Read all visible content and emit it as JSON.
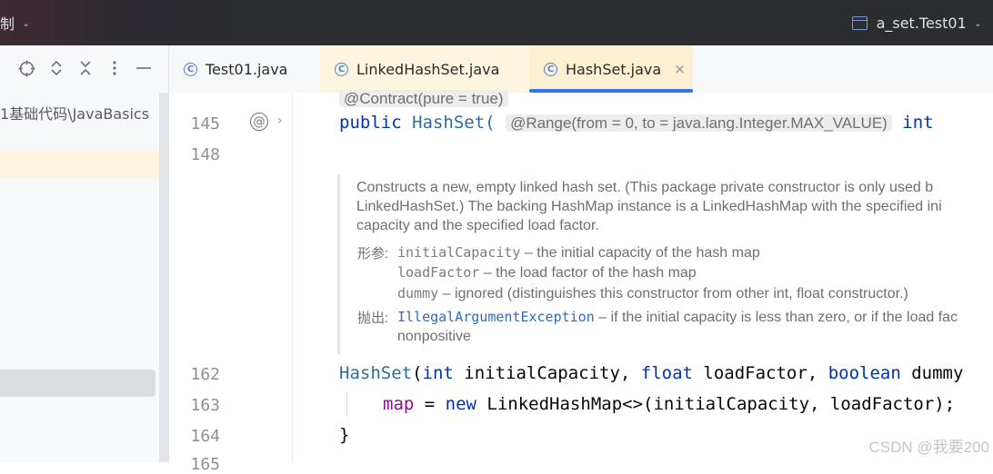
{
  "titlebar": {
    "left_text": "制",
    "run_config": "a_set.Test01"
  },
  "left_panel": {
    "path_text": "1基础代码\\JavaBasics"
  },
  "tabs": [
    {
      "label": "Test01.java",
      "active": false
    },
    {
      "label": "LinkedHashSet.java",
      "active": false
    },
    {
      "label": "HashSet.java",
      "active": true,
      "close": "×"
    }
  ],
  "editor": {
    "contract_hint": "@Contract(pure = true)",
    "lines": [
      {
        "number": "145"
      },
      {
        "number": "148"
      },
      {
        "number": "162"
      },
      {
        "number": "163"
      },
      {
        "number": "164"
      },
      {
        "number": "165"
      }
    ],
    "line145": {
      "kw_public": "public",
      "name": "HashSet(",
      "range_hint": "@Range(from = 0, to = java.lang.Integer.MAX_VALUE)",
      "kw_int": "int"
    },
    "line162": {
      "name": "HashSet",
      "p1": "(",
      "kw_int": "int",
      "t1": " initialCapacity, ",
      "kw_float": "float",
      "t2": " loadFactor, ",
      "kw_boolean": "boolean",
      "t3": " dummy"
    },
    "line163": {
      "field": "map",
      "t1": " = ",
      "kw_new": "new",
      "t2": " LinkedHashMap<>(initialCapacity, loadFactor);"
    },
    "line164": {
      "brace": "}"
    }
  },
  "javadoc": {
    "desc_line1": "Constructs a new, empty linked hash set. (This package private constructor is only used b",
    "desc_line2": "LinkedHashSet.) The backing HashMap instance is a LinkedHashMap with the specified ini",
    "desc_line3": "capacity and the specified load factor.",
    "params_label": "形参:",
    "params": [
      {
        "name": "initialCapacity",
        "desc": " – the initial capacity of the hash map"
      },
      {
        "name": "loadFactor",
        "desc": " – the load factor of the hash map"
      },
      {
        "name": "dummy",
        "desc": " – ignored (distinguishes this constructor from other int, float constructor.)"
      }
    ],
    "throws_label": "抛出:",
    "throws": {
      "name": "IllegalArgumentException",
      "desc": " – if the initial capacity is less than zero, or if the load fac",
      "desc2": "nonpositive"
    }
  },
  "watermark": "CSDN @我要200"
}
